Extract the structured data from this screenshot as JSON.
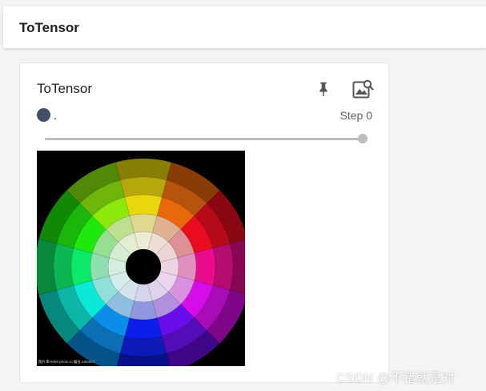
{
  "header": {
    "title": "ToTensor"
  },
  "card": {
    "title": "ToTensor",
    "run_label": ".",
    "step_label": "Step 0",
    "slider_value": 1.0,
    "pin_icon": "pin-icon",
    "image_search_icon": "image-search-icon",
    "run_color": "#425066",
    "image": {
      "caption": "图片来Yefeit-photo.ru 编号:10846.7"
    }
  },
  "watermark": "CSDN @不错就是对"
}
